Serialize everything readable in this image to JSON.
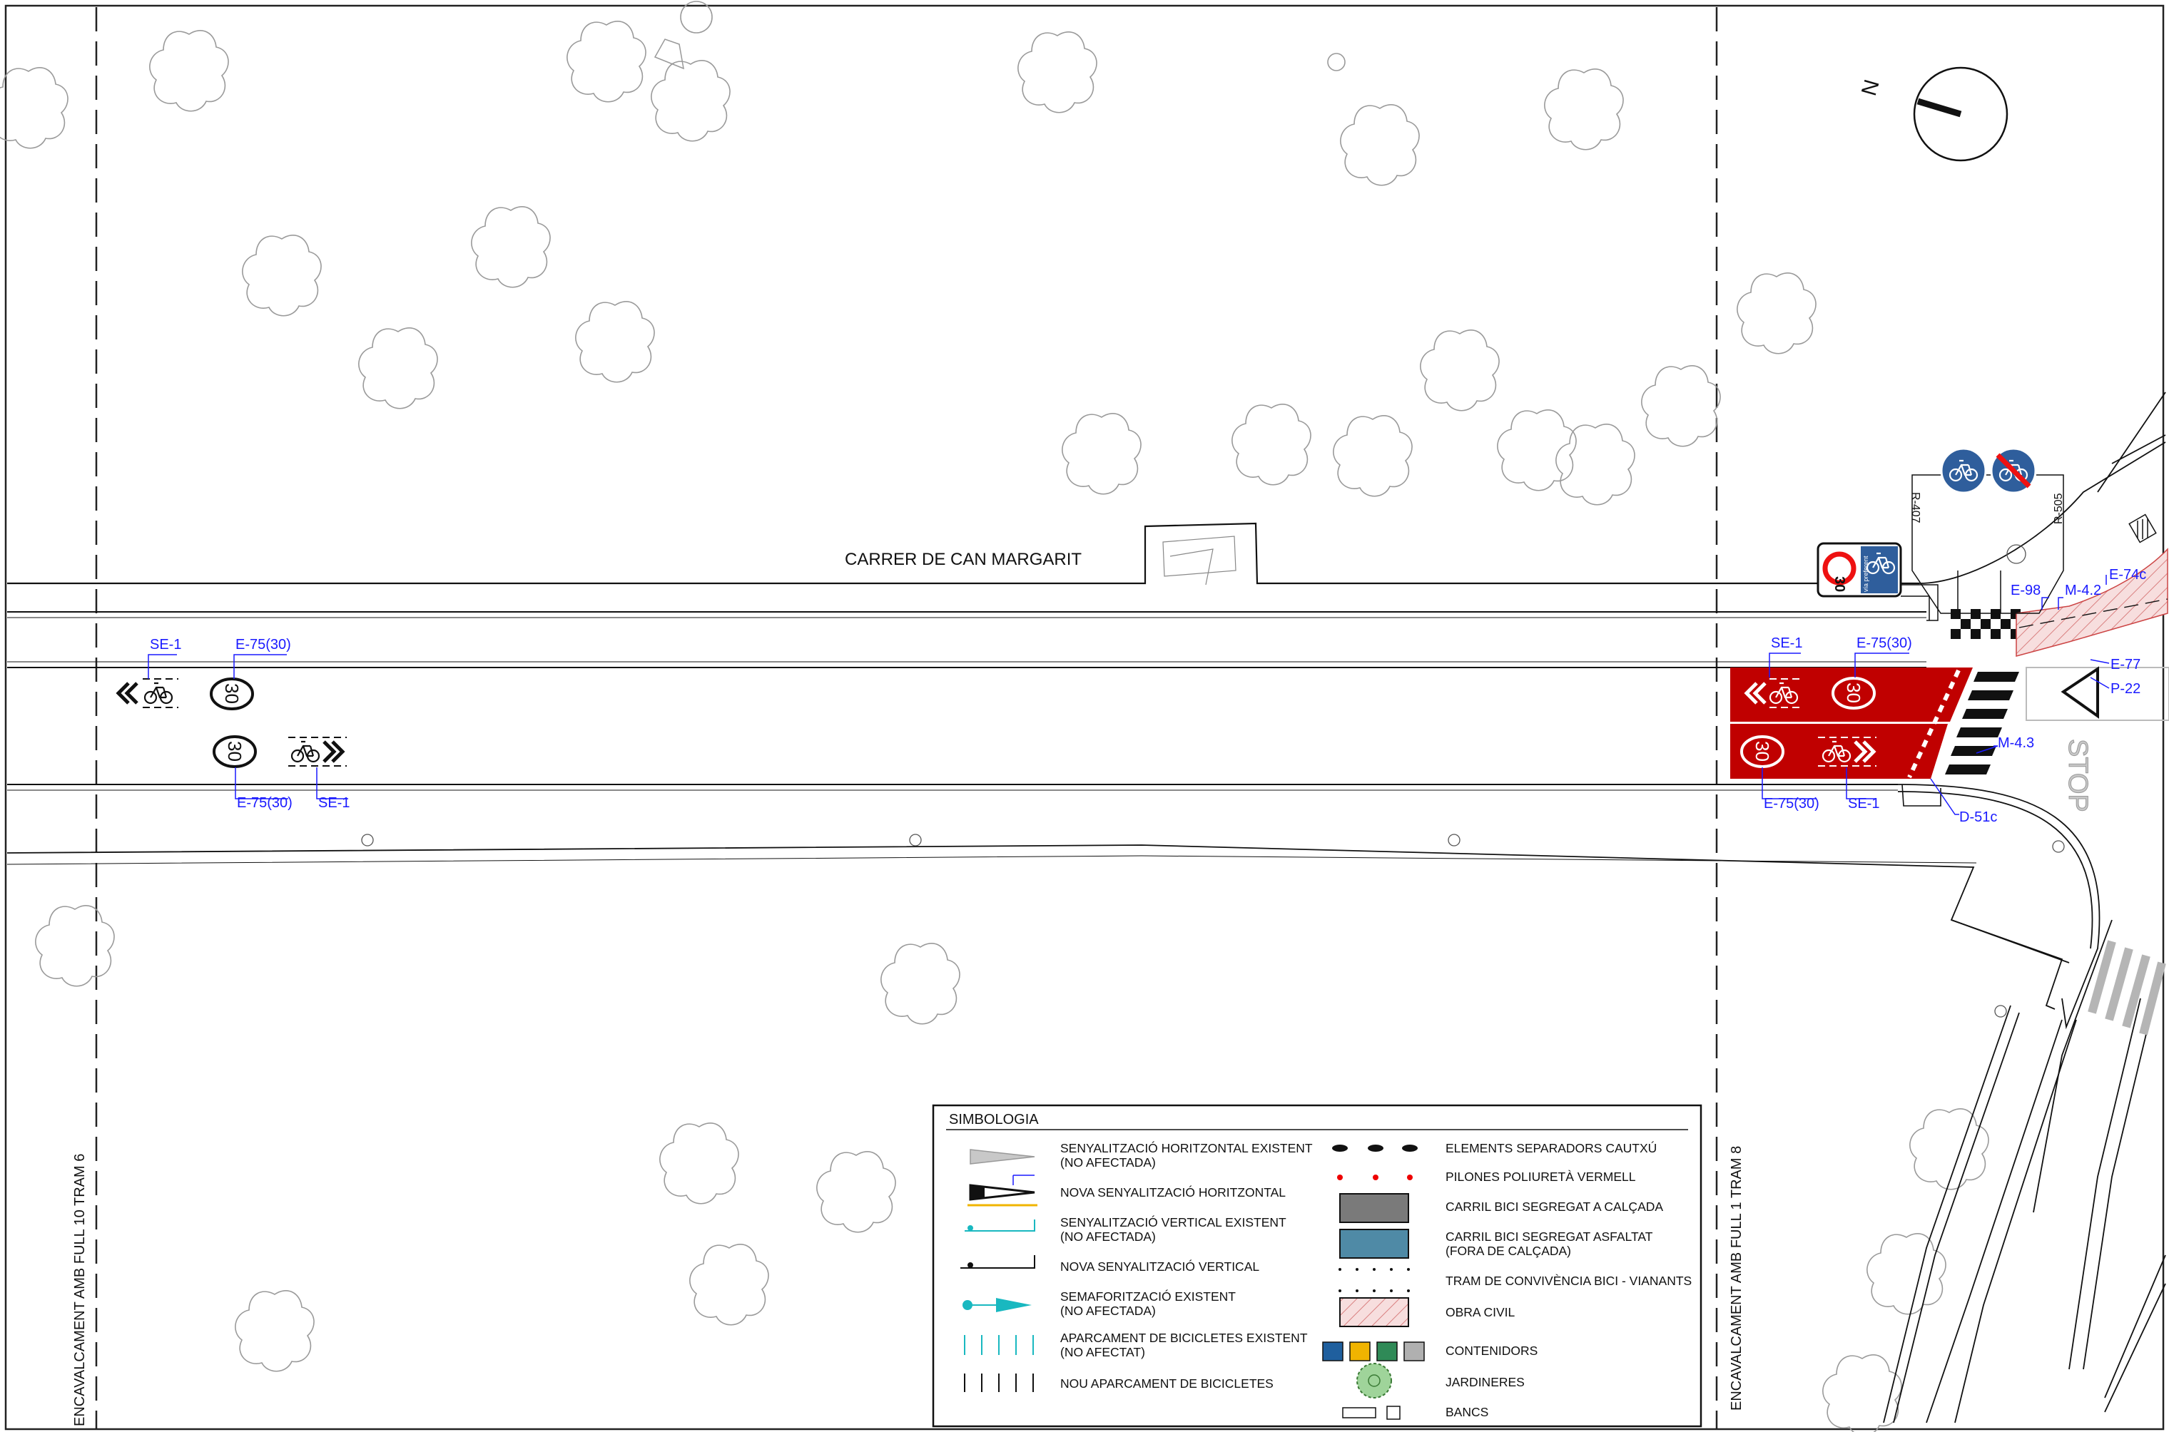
{
  "street_name": "CARRER DE CAN MARGARIT",
  "overlap_left": "ENCAVALCAMENT AMB FULL 10 TRAM 6",
  "overlap_right": "ENCAVALCAMENT AMB FULL 1 TRAM 8",
  "north_label": "N",
  "stop_text": "STOP",
  "speed_value": "30",
  "tags": {
    "se1": "SE-1",
    "e75": "E-75(30)",
    "m43": "M-4.3",
    "d51c": "D-51c",
    "p22": "P-22",
    "e77": "E-77",
    "m42": "M-4.2",
    "e98": "E-98",
    "e74c": "E-74c",
    "r407": "R-407",
    "r505": "R-505"
  },
  "sign_panel": {
    "speed": "30",
    "small_text": "zona",
    "bike_text": "vía preferent"
  },
  "legend": {
    "title": "SIMBOLOGIA",
    "left": [
      {
        "l1": "SENYALITZACIÓ HORITZONTAL EXISTENT",
        "l2": "(NO AFECTADA)"
      },
      {
        "l1": "NOVA SENYALITZACIÓ HORITZONTAL",
        "l2": ""
      },
      {
        "l1": "SENYALITZACIÓ VERTICAL EXISTENT",
        "l2": "(NO AFECTADA)"
      },
      {
        "l1": "NOVA SENYALITZACIÓ VERTICAL",
        "l2": ""
      },
      {
        "l1": "SEMAFORITZACIÓ EXISTENT",
        "l2": "(NO AFECTADA)"
      },
      {
        "l1": "APARCAMENT DE BICICLETES EXISTENT",
        "l2": "(NO AFECTAT)"
      },
      {
        "l1": "NOU APARCAMENT DE BICICLETES",
        "l2": ""
      }
    ],
    "right": [
      {
        "l1": "ELEMENTS SEPARADORS CAUTXÚ",
        "l2": ""
      },
      {
        "l1": "PILONES POLIURETÀ VERMELL",
        "l2": ""
      },
      {
        "l1": "CARRIL BICI SEGREGAT A CALÇADA",
        "l2": ""
      },
      {
        "l1": "CARRIL BICI SEGREGAT ASFALTAT",
        "l2": "(FORA DE CALÇADA)"
      },
      {
        "l1": "TRAM DE CONVIVÈNCIA BICI - VIANANTS",
        "l2": ""
      },
      {
        "l1": "OBRA CIVIL",
        "l2": ""
      },
      {
        "l1": "CONTENIDORS",
        "l2": ""
      },
      {
        "l1": "JARDINERES",
        "l2": ""
      },
      {
        "l1": "BANCS",
        "l2": ""
      }
    ]
  },
  "colors": {
    "line": "#111111",
    "annotation": "#1a1aff",
    "bike_lane": "#c00000",
    "tree": "#9a9a9a",
    "cyan": "#19b8c0",
    "yellow": "#f0b400",
    "sign_blue": "#2f5e9c",
    "obra_civil": "#f7dede"
  }
}
